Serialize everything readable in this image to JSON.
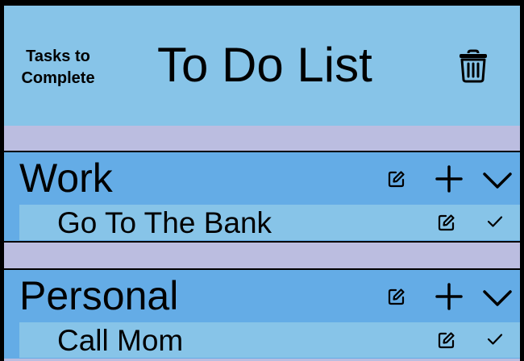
{
  "header": {
    "tasks_label_line1": "Tasks to",
    "tasks_label_line2": "Complete",
    "title": "To Do List",
    "trash_icon": "trash-icon"
  },
  "categories": [
    {
      "name": "Work",
      "icons": [
        "edit-icon",
        "plus-icon",
        "chevron-down-icon"
      ],
      "tasks": [
        {
          "name": "Go To The Bank",
          "icons": [
            "edit-icon",
            "checkmark-icon"
          ]
        }
      ]
    },
    {
      "name": "Personal",
      "icons": [
        "edit-icon",
        "plus-icon",
        "chevron-down-icon"
      ],
      "tasks": [
        {
          "name": "Call Mom",
          "icons": [
            "edit-icon",
            "checkmark-icon"
          ]
        }
      ]
    }
  ],
  "colors": {
    "header_bg": "#87c4e8",
    "category_bg": "#64ace6",
    "task_bg": "#87c4e8",
    "gap_bg": "#bbbde0",
    "frame": "#000000"
  }
}
